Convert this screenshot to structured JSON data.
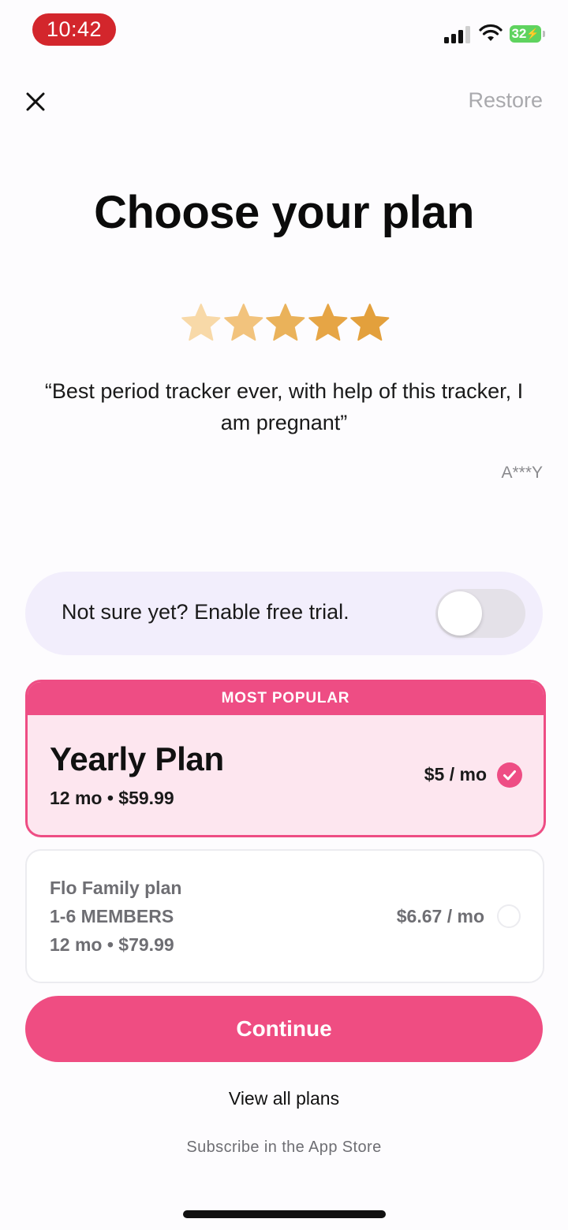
{
  "status_bar": {
    "time": "10:42",
    "battery": "32",
    "icons": [
      "cellular-signal-icon",
      "wifi-icon",
      "battery-charging-icon"
    ]
  },
  "nav": {
    "close_icon": "close-icon",
    "restore_label": "Restore"
  },
  "header": {
    "title": "Choose your plan"
  },
  "review": {
    "rating": 5,
    "rating_max": 5,
    "star_colors": [
      "#f8d9a8",
      "#f2c37d",
      "#eab25a",
      "#e6a545",
      "#e3a03c"
    ],
    "quote": "“Best period tracker ever, with help of this tracker, I am pregnant”",
    "author": "A***Y"
  },
  "trial": {
    "label": "Not sure yet? Enable free trial.",
    "enabled": false
  },
  "plans": [
    {
      "badge": "MOST POPULAR",
      "name": "Yearly Plan",
      "detail": "12 mo • $59.99",
      "price": "$5 / mo",
      "selected": true
    },
    {
      "name": "Flo Family plan",
      "members": "1-6 MEMBERS",
      "detail": "12 mo • $79.99",
      "price": "$6.67 / mo",
      "selected": false
    }
  ],
  "actions": {
    "continue_label": "Continue",
    "view_all_label": "View all plans",
    "subscribe_note": "Subscribe in the App Store"
  },
  "colors": {
    "accent": "#ee4d84",
    "selected_plan_bg": "#fde6ef",
    "trial_bg": "#f2eefc",
    "status_pill": "#d3262c",
    "battery": "#5fd35f"
  }
}
